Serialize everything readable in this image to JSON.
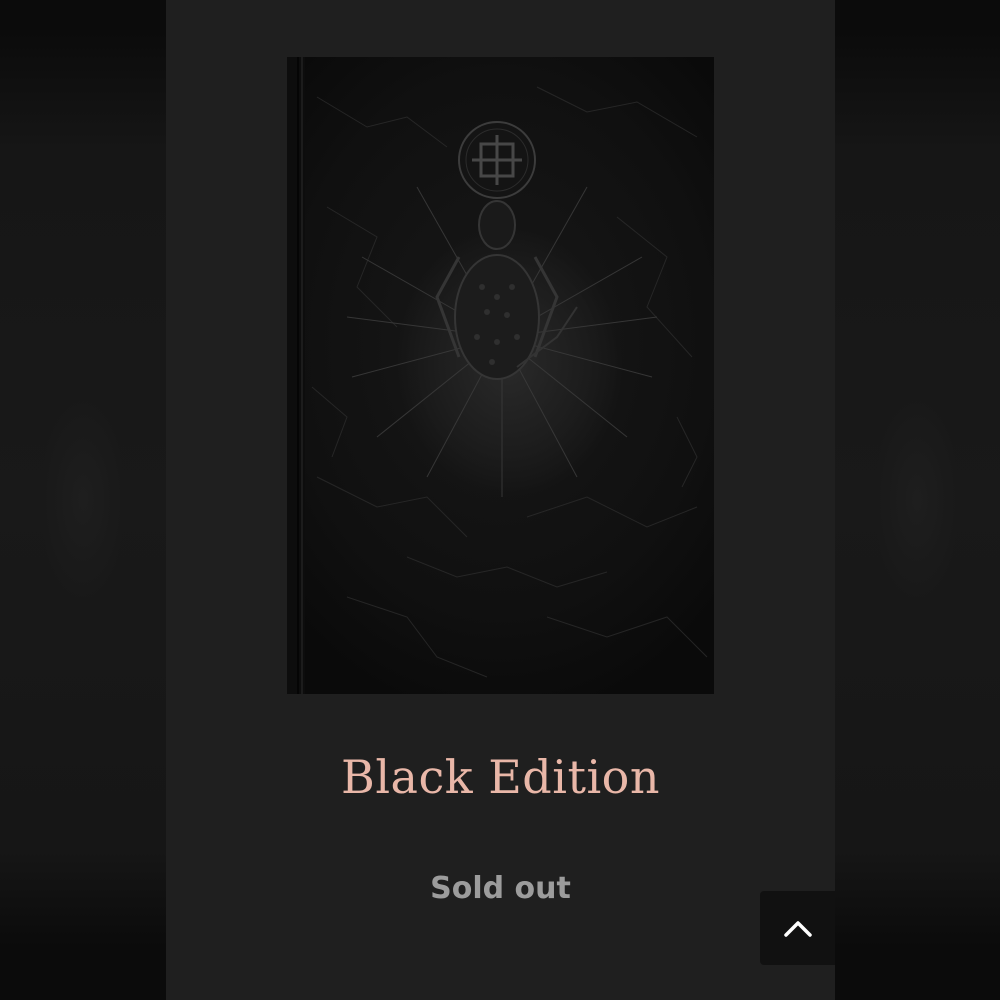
{
  "product": {
    "title": "Black Edition",
    "status": "Sold out",
    "image": {
      "subject": "black embossed leather book cover with sigil, figure and radiating lines"
    }
  },
  "controls": {
    "scroll_to_top_icon": "chevron-up-icon"
  },
  "colors": {
    "title": "#e9b7a8",
    "status": "#9c9c9c",
    "panel": "#1f1f1f"
  }
}
